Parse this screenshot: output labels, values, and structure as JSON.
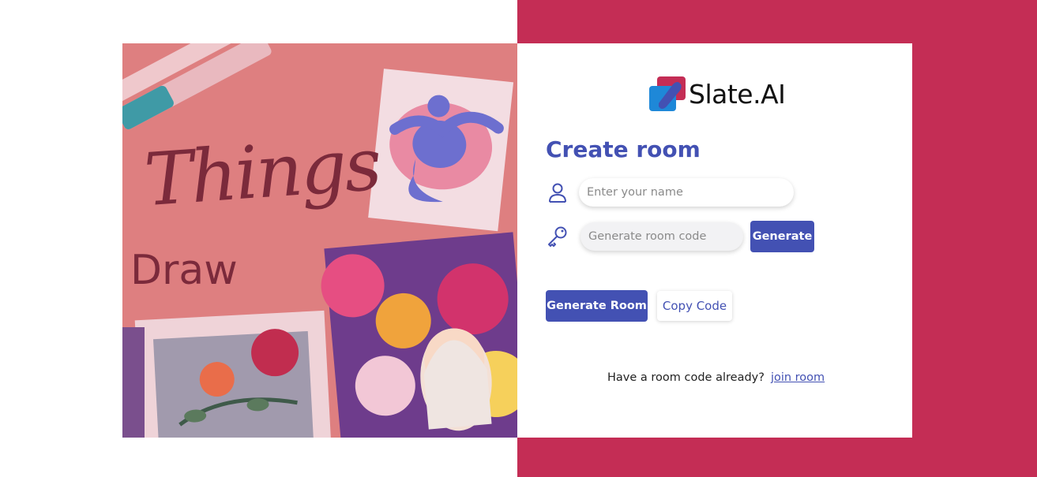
{
  "colors": {
    "brand_primary": "#4351b3",
    "background_accent": "#c42d55",
    "art_overlay": "#de7f80",
    "logo_red": "#c42d55",
    "logo_blue": "#1e88d8"
  },
  "hero_image": {
    "script_text": "Things",
    "word": "Draw"
  },
  "logo": {
    "icon": "slate-logo-icon",
    "text": "Slate.AI"
  },
  "form": {
    "title": "Create room",
    "name_field": {
      "icon": "user-icon",
      "placeholder": "Enter your name",
      "value": ""
    },
    "code_field": {
      "icon": "key-icon",
      "placeholder": "Generate room code",
      "value": ""
    },
    "generate_label": "Generate",
    "generate_room_label": "Generate Room",
    "copy_code_label": "Copy Code"
  },
  "footer": {
    "prompt": "Have a room code already?",
    "link": "join room"
  }
}
